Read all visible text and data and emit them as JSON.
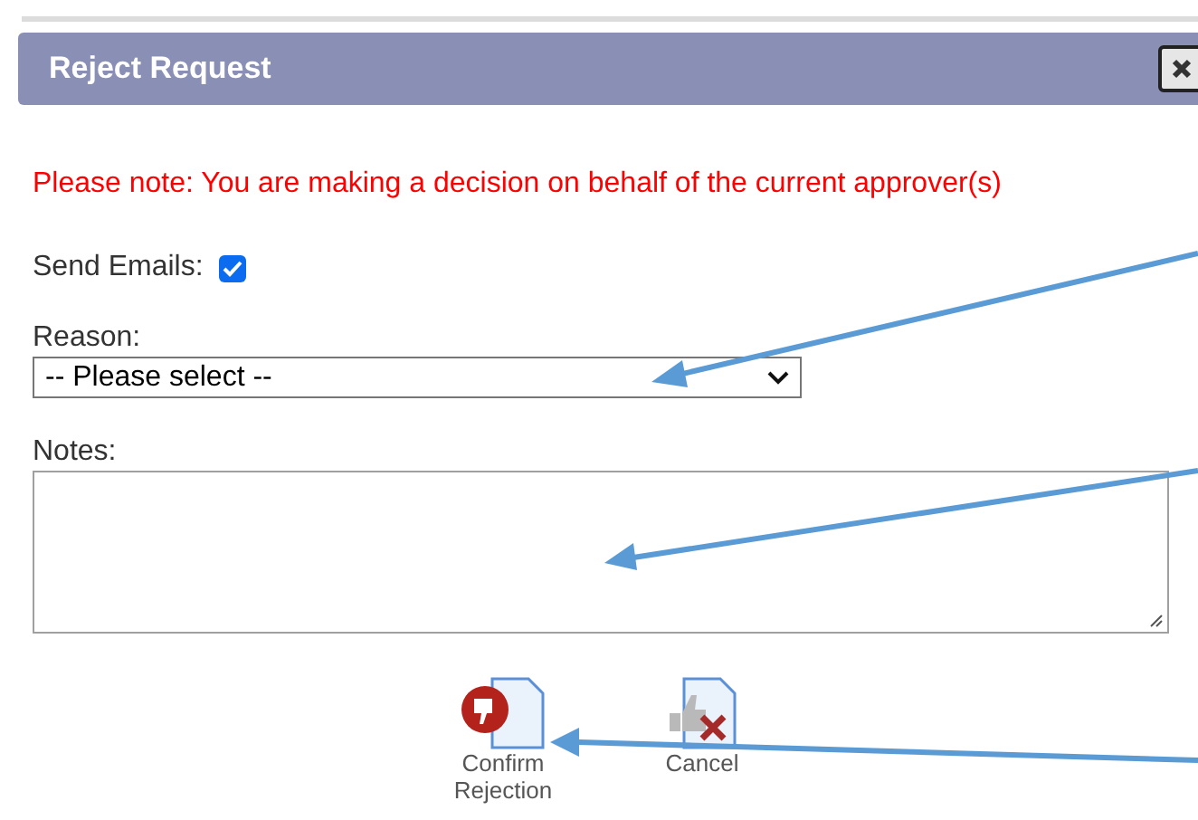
{
  "dialog": {
    "title": "Reject Request"
  },
  "notice": "Please note: You are making a decision on behalf of the current approver(s)",
  "send_emails": {
    "label": "Send Emails:",
    "checked": true
  },
  "reason": {
    "label": "Reason:",
    "value": "-- Please select --"
  },
  "notes": {
    "label": "Notes:"
  },
  "buttons": [
    {
      "kind": "confirm",
      "label": "Confirm Rejection"
    },
    {
      "kind": "cancel",
      "label": "Cancel"
    }
  ]
}
